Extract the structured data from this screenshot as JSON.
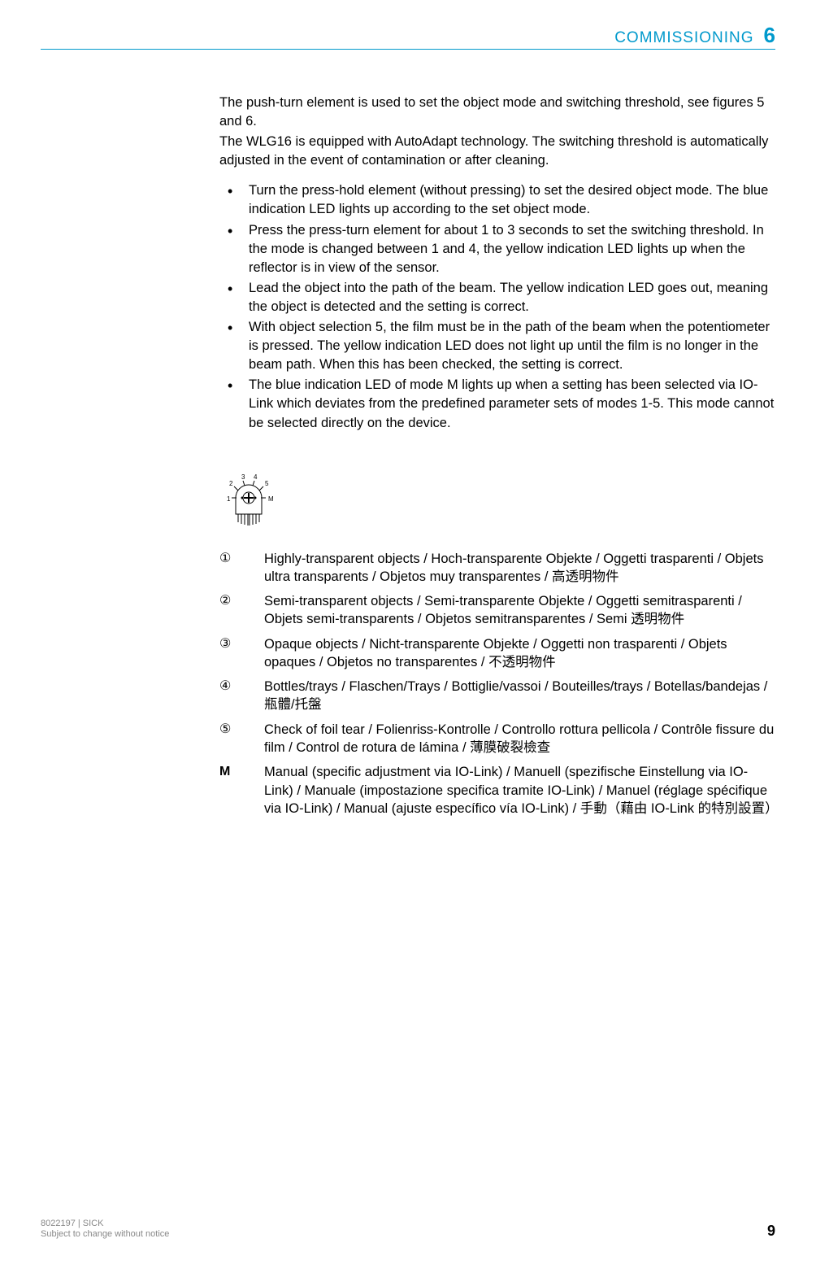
{
  "header": {
    "title": "COMMISSIONING",
    "section_num": "6"
  },
  "intro": {
    "p1": "The push-turn element is used to set the object mode and switching threshold, see figures 5 and 6.",
    "p2": "The WLG16 is equipped with AutoAdapt technology. The switching threshold is automati­cally adjusted in the event of contamination or after cleaning."
  },
  "bullets": [
    "Turn the press-hold element (without pressing) to set the desired object mode. The blue indication LED lights up according to the set object mode.",
    "Press the press-turn element for about 1 to 3 seconds to set the switching threshold. In the mode is changed between 1 and 4, the yellow indication LED lights up when the reflector is in view of the sensor.",
    "Lead the object into the path of the beam. The yellow indication LED goes out, mean­ing the object is detected and the setting is correct.",
    "With object selection 5, the film must be in the path of the beam when the poten­tiometer is pressed. The yellow indication LED does not light up until the film is no longer in the beam path. When this has been checked, the setting is correct.",
    "The blue indication LED of mode M lights up when a setting has been selected via IO-Link which deviates from the predefined parameter sets of modes 1-5. This mode cannot be selected directly on the device."
  ],
  "diagram_labels": {
    "l1": "1",
    "l2": "2",
    "l3": "3",
    "l4": "4",
    "l5": "5",
    "lm": "M"
  },
  "legend": [
    {
      "num": "①",
      "text": "Highly-transparent objects / Hoch-transparente Objekte / Oggetti trasparenti / Objets ultra transparents / Objetos muy transparentes / 高透明物件"
    },
    {
      "num": "②",
      "text": "Semi-transparent objects / Semi-transparente Objekte / Oggetti semitrasparenti / Objets semi-transparents / Objetos semitransparentes / Semi 透明物件"
    },
    {
      "num": "③",
      "text": "Opaque objects / Nicht-transparente Objekte / Oggetti non trasparenti / Objets opaques / Objetos no transparentes / 不透明物件"
    },
    {
      "num": "④",
      "text": "Bottles/trays / Flaschen/Trays / Bottiglie/vassoi / Bouteilles/trays / Botellas/bandejas / 瓶體/托盤"
    },
    {
      "num": "⑤",
      "text": "Check of foil tear / Folienriss-Kontrolle / Controllo rottura pellicola / Contrôle fis­sure du film / Control de rotura de lámina / 薄膜破裂檢查"
    },
    {
      "num": "M",
      "text": "Manual (specific adjustment via IO-Link) / Manuell (spezifische Einstellung via IO-Link) / Manuale (impostazione specifica tramite IO-Link) / Manuel (réglage spécifique via IO-Link) / Manual (ajuste específico vía IO-Link) / 手動（藉由 IO-Link 的特別設置）"
    }
  ],
  "footer": {
    "doc_id": "8022197 | SICK",
    "notice": "Subject to change without notice",
    "page": "9"
  }
}
